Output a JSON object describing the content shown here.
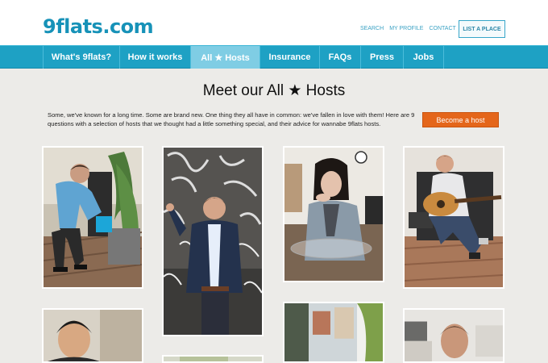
{
  "header": {
    "logo": "9flats.com",
    "links": [
      "SEARCH",
      "MY PROFILE",
      "CONTACT"
    ],
    "list_button": "LIST A PLACE"
  },
  "nav": {
    "items": [
      "What's 9flats?",
      "How it works",
      "All ★ Hosts",
      "Insurance",
      "FAQs",
      "Press",
      "Jobs"
    ],
    "active": "All ★ Hosts"
  },
  "main": {
    "title": "Meet our All ★ Hosts",
    "intro": "Some, we've known for a long time. Some are brand new. One thing they all have in common: we've fallen in love with them! Here are 9 questions with a selection of hosts that we thought had a little something special, and their advice for wannabe 9flats hosts.",
    "become_button": "Become a host"
  }
}
